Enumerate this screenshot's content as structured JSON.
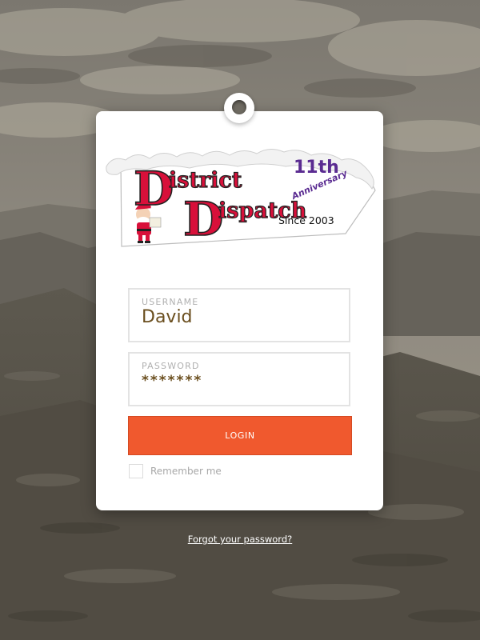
{
  "logo": {
    "line1": "istrict",
    "line2": "ispatch",
    "initial1": "D",
    "initial2": "D",
    "anniversary_number": "11th",
    "anniversary_label": "Anniversary",
    "since": "Since 2003",
    "colors": {
      "red": "#d8103a",
      "purple": "#5a2b91"
    }
  },
  "form": {
    "username": {
      "label": "USERNAME",
      "value": "David"
    },
    "password": {
      "label": "PASSWORD",
      "value": "*******"
    },
    "login_label": "LOGIN",
    "remember_label": "Remember me",
    "remember_checked": false
  },
  "forgot_label": "Forgot your password?",
  "colors": {
    "accent": "#f0592e",
    "value_text": "#6a4e1e",
    "label_text": "#b0b0b0"
  }
}
